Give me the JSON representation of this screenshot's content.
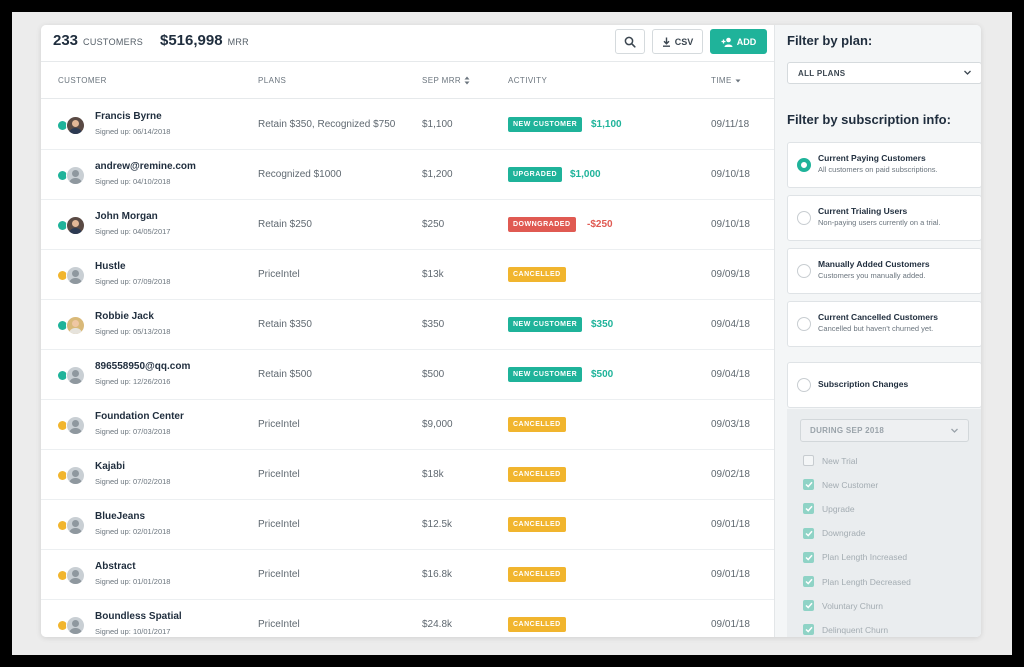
{
  "header": {
    "customers_count": "233",
    "customers_label": "CUSTOMERS",
    "mrr_value": "$516,998",
    "mrr_label": "MRR",
    "csv_label": "CSV",
    "add_label": "ADD"
  },
  "columns": {
    "customer": "CUSTOMER",
    "plans": "PLANS",
    "sep_mrr": "SEP MRR",
    "activity": "ACTIVITY",
    "time": "TIME"
  },
  "rows": [
    {
      "name": "Francis Byrne",
      "signed": "Signed up: 06/14/2018",
      "plan": "Retain $350, Recognized $750",
      "mrr": "$1,100",
      "activity": "NEW CUSTOMER",
      "amount": "$1,100",
      "time": "09/11/18"
    },
    {
      "name": "andrew@remine.com",
      "signed": "Signed up: 04/10/2018",
      "plan": "Recognized $1000",
      "mrr": "$1,200",
      "activity": "UPGRADED",
      "amount": "$1,000",
      "time": "09/10/18"
    },
    {
      "name": "John Morgan",
      "signed": "Signed up: 04/05/2017",
      "plan": "Retain $250",
      "mrr": "$250",
      "activity": "DOWNGRADED",
      "amount": "-$250",
      "time": "09/10/18"
    },
    {
      "name": "Hustle",
      "signed": "Signed up: 07/09/2018",
      "plan": "PriceIntel",
      "mrr": "$13k",
      "activity": "CANCELLED",
      "amount": "",
      "time": "09/09/18"
    },
    {
      "name": "Robbie Jack",
      "signed": "Signed up: 05/13/2018",
      "plan": "Retain $350",
      "mrr": "$350",
      "activity": "NEW CUSTOMER",
      "amount": "$350",
      "time": "09/04/18"
    },
    {
      "name": "896558950@qq.com",
      "signed": "Signed up: 12/26/2016",
      "plan": "Retain $500",
      "mrr": "$500",
      "activity": "NEW CUSTOMER",
      "amount": "$500",
      "time": "09/04/18"
    },
    {
      "name": "Foundation Center",
      "signed": "Signed up: 07/03/2018",
      "plan": "PriceIntel",
      "mrr": "$9,000",
      "activity": "CANCELLED",
      "amount": "",
      "time": "09/03/18"
    },
    {
      "name": "Kajabi",
      "signed": "Signed up: 07/02/2018",
      "plan": "PriceIntel",
      "mrr": "$18k",
      "activity": "CANCELLED",
      "amount": "",
      "time": "09/02/18"
    },
    {
      "name": "BlueJeans",
      "signed": "Signed up: 02/01/2018",
      "plan": "PriceIntel",
      "mrr": "$12.5k",
      "activity": "CANCELLED",
      "amount": "",
      "time": "09/01/18"
    },
    {
      "name": "Abstract",
      "signed": "Signed up: 01/01/2018",
      "plan": "PriceIntel",
      "mrr": "$16.8k",
      "activity": "CANCELLED",
      "amount": "",
      "time": "09/01/18"
    },
    {
      "name": "Boundless Spatial",
      "signed": "Signed up: 10/01/2017",
      "plan": "PriceIntel",
      "mrr": "$24.8k",
      "activity": "CANCELLED",
      "amount": "",
      "time": "09/01/18"
    }
  ],
  "sidebar": {
    "filter_plan_title": "Filter by plan:",
    "plan_select": "ALL PLANS",
    "filter_sub_title": "Filter by subscription info:",
    "options": [
      {
        "title": "Current Paying Customers",
        "desc": "All customers on paid subscriptions."
      },
      {
        "title": "Current Trialing Users",
        "desc": "Non-paying users currently on a trial."
      },
      {
        "title": "Manually Added Customers",
        "desc": "Customers you manually added."
      },
      {
        "title": "Current Cancelled Customers",
        "desc": "Cancelled but haven't churned yet."
      }
    ],
    "changes_title": "Subscription Changes",
    "period_select": "DURING SEP 2018",
    "checkboxes": [
      {
        "label": "New Trial",
        "checked": false
      },
      {
        "label": "New Customer",
        "checked": true
      },
      {
        "label": "Upgrade",
        "checked": true
      },
      {
        "label": "Downgrade",
        "checked": true
      },
      {
        "label": "Plan Length Increased",
        "checked": true
      },
      {
        "label": "Plan Length Decreased",
        "checked": true
      },
      {
        "label": "Voluntary Churn",
        "checked": true
      },
      {
        "label": "Delinquent Churn",
        "checked": true
      }
    ]
  },
  "colors": {
    "accent": "#1fb39a",
    "down": "#e05a52",
    "cancelled": "#f1b52e"
  }
}
